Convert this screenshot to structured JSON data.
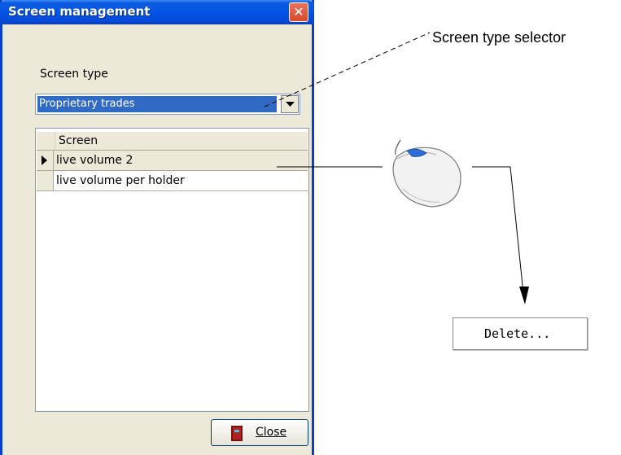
{
  "window": {
    "title": "Screen management"
  },
  "screen_type": {
    "label": "Screen type",
    "selected": "Proprietary trades"
  },
  "grid": {
    "column_header": "Screen",
    "rows": [
      {
        "name": "live volume 2",
        "selected": true
      },
      {
        "name": "live volume per holder",
        "selected": false
      }
    ]
  },
  "footer": {
    "close_label": "Close"
  },
  "annotations": {
    "selector_callout": "Screen type selector",
    "context_menu_item": "Delete..."
  },
  "colors": {
    "title_bar": "#0555e6",
    "selection": "#316ac5",
    "dialog_bg": "#ece9d8"
  }
}
